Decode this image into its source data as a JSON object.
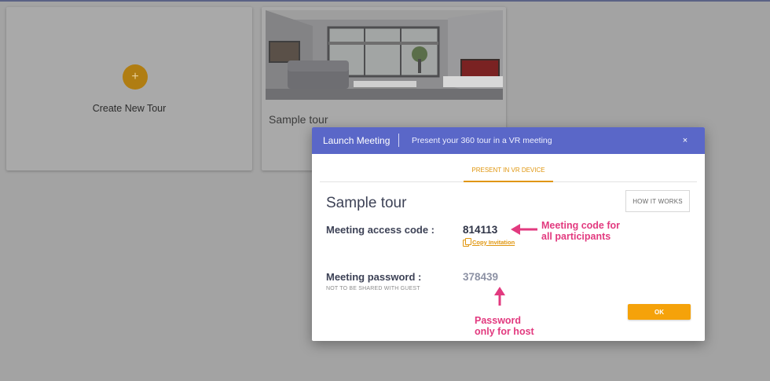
{
  "background": {
    "create_card": {
      "label": "Create New Tour",
      "icon": "plus-icon",
      "button_glyph": "+"
    },
    "sample_card": {
      "title": "Sample tour"
    }
  },
  "modal": {
    "title": "Launch Meeting",
    "subtitle": "Present your 360 tour in a VR meeting",
    "close_glyph": "×",
    "tabs": [
      {
        "label": "PRESENT IN VR DEVICE",
        "active": true
      }
    ],
    "tour_title": "Sample tour",
    "how_it_works": "HOW IT WORKS",
    "access_code_label": "Meeting access code :",
    "access_code": "814113",
    "copy_invitation": "Copy Invitation",
    "password_label": "Meeting password :",
    "password_note": "NOT TO BE SHARED WITH GUEST",
    "password": "378439",
    "ok": "OK"
  },
  "annotations": {
    "code_note_line1": "Meeting code for",
    "code_note_line2": "all participants",
    "pass_note_line1": "Password",
    "pass_note_line2": "only for host"
  },
  "colors": {
    "header": "#5a67c8",
    "accent": "#f5a20a",
    "annotation": "#e23a7f",
    "overlay": "#a3a3a3"
  }
}
